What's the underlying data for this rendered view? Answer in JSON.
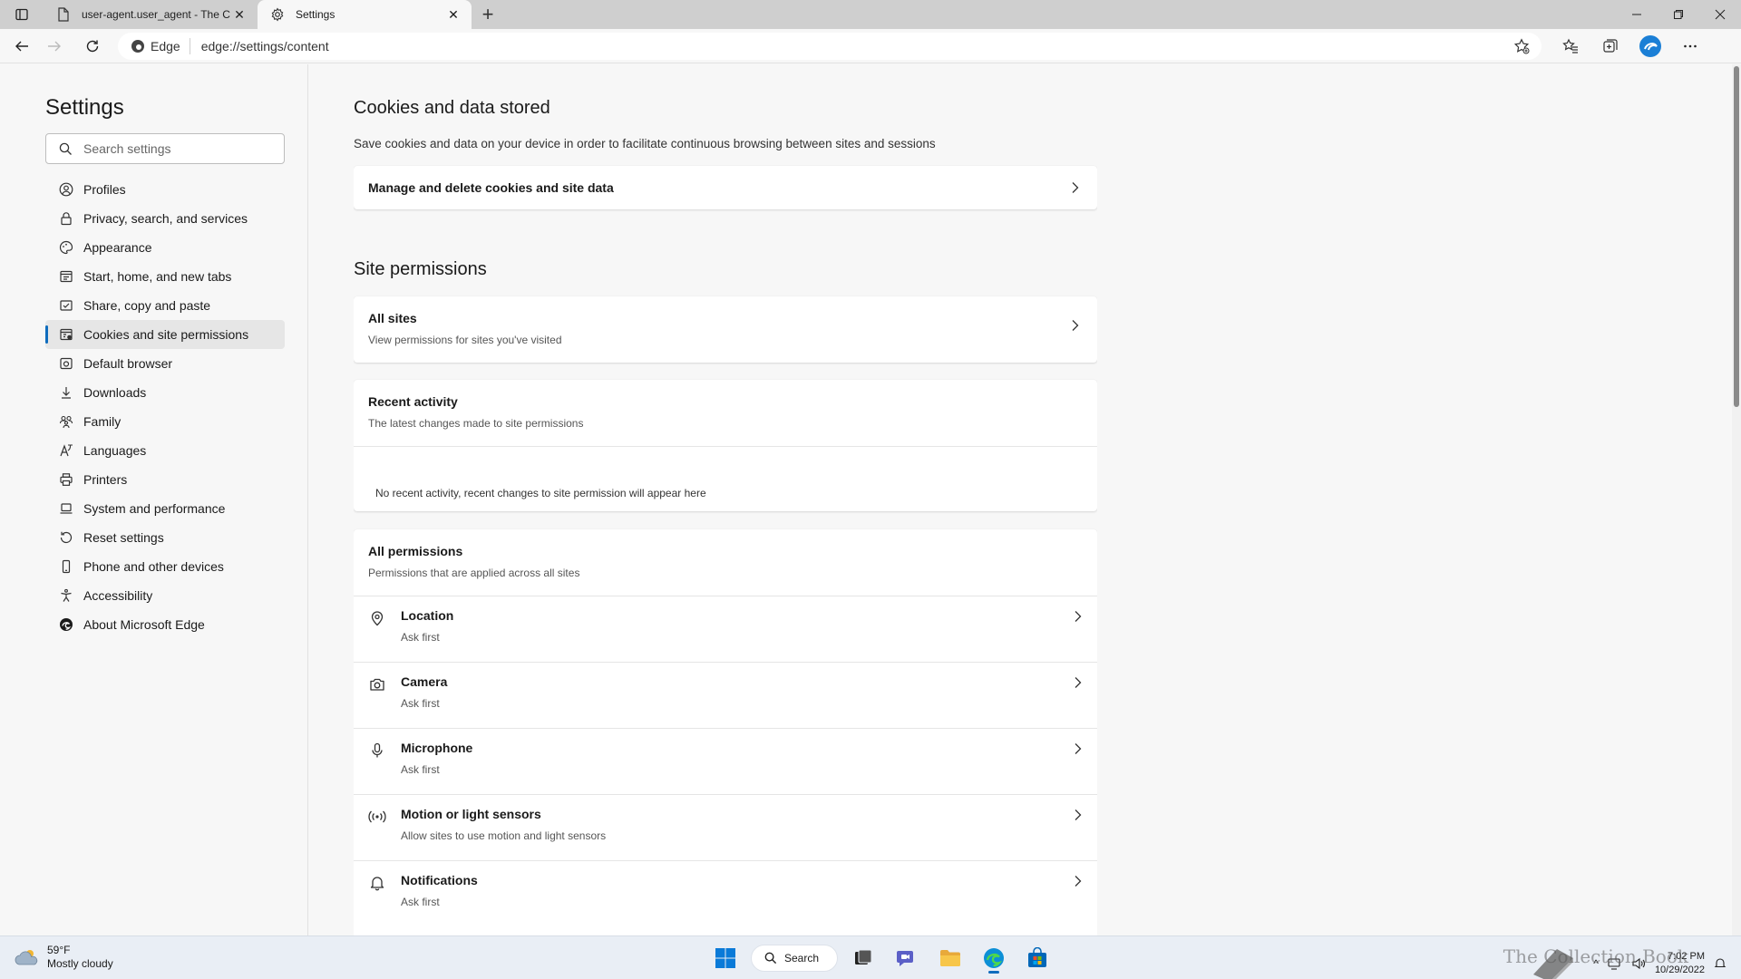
{
  "tabs": [
    {
      "title": "user-agent.user_agent - The Coll",
      "active": false
    },
    {
      "title": "Settings",
      "active": true
    }
  ],
  "toolbar": {
    "site_label": "Edge",
    "url": "edge://settings/content"
  },
  "sidebar": {
    "title": "Settings",
    "search_placeholder": "Search settings",
    "items": [
      {
        "label": "Profiles",
        "icon": "profile-icon"
      },
      {
        "label": "Privacy, search, and services",
        "icon": "lock-icon"
      },
      {
        "label": "Appearance",
        "icon": "palette-icon"
      },
      {
        "label": "Start, home, and new tabs",
        "icon": "home-icon"
      },
      {
        "label": "Share, copy and paste",
        "icon": "share-icon"
      },
      {
        "label": "Cookies and site permissions",
        "icon": "cookies-icon",
        "active": true
      },
      {
        "label": "Default browser",
        "icon": "browser-icon"
      },
      {
        "label": "Downloads",
        "icon": "download-icon"
      },
      {
        "label": "Family",
        "icon": "family-icon"
      },
      {
        "label": "Languages",
        "icon": "languages-icon"
      },
      {
        "label": "Printers",
        "icon": "printer-icon"
      },
      {
        "label": "System and performance",
        "icon": "laptop-icon"
      },
      {
        "label": "Reset settings",
        "icon": "reset-icon"
      },
      {
        "label": "Phone and other devices",
        "icon": "phone-icon"
      },
      {
        "label": "Accessibility",
        "icon": "accessibility-icon"
      },
      {
        "label": "About Microsoft Edge",
        "icon": "edge-icon"
      }
    ]
  },
  "content": {
    "cookies_heading": "Cookies and data stored",
    "cookies_desc": "Save cookies and data on your device in order to facilitate continuous browsing between sites and sessions",
    "manage_cookies": "Manage and delete cookies and site data",
    "site_permissions_heading": "Site permissions",
    "all_sites": {
      "title": "All sites",
      "subtitle": "View permissions for sites you've visited"
    },
    "recent_activity": {
      "title": "Recent activity",
      "subtitle": "The latest changes made to site permissions",
      "empty": "No recent activity, recent changes to site permission will appear here"
    },
    "all_permissions": {
      "title": "All permissions",
      "subtitle": "Permissions that are applied across all sites",
      "items": [
        {
          "name": "Location",
          "value": "Ask first",
          "icon": "location-icon"
        },
        {
          "name": "Camera",
          "value": "Ask first",
          "icon": "camera-icon"
        },
        {
          "name": "Microphone",
          "value": "Ask first",
          "icon": "microphone-icon"
        },
        {
          "name": "Motion or light sensors",
          "value": "Allow sites to use motion and light sensors",
          "icon": "sensors-icon"
        },
        {
          "name": "Notifications",
          "value": "Ask first",
          "icon": "bell-icon"
        }
      ]
    }
  },
  "taskbar": {
    "weather_temp": "59°F",
    "weather_desc": "Mostly cloudy",
    "search_label": "Search",
    "time": "7:02 PM",
    "date": "10/29/2022",
    "watermark": "The Collection Book"
  },
  "colors": {
    "accent": "#0f6cbd",
    "background": "#f7f7f7",
    "card": "#ffffff"
  }
}
